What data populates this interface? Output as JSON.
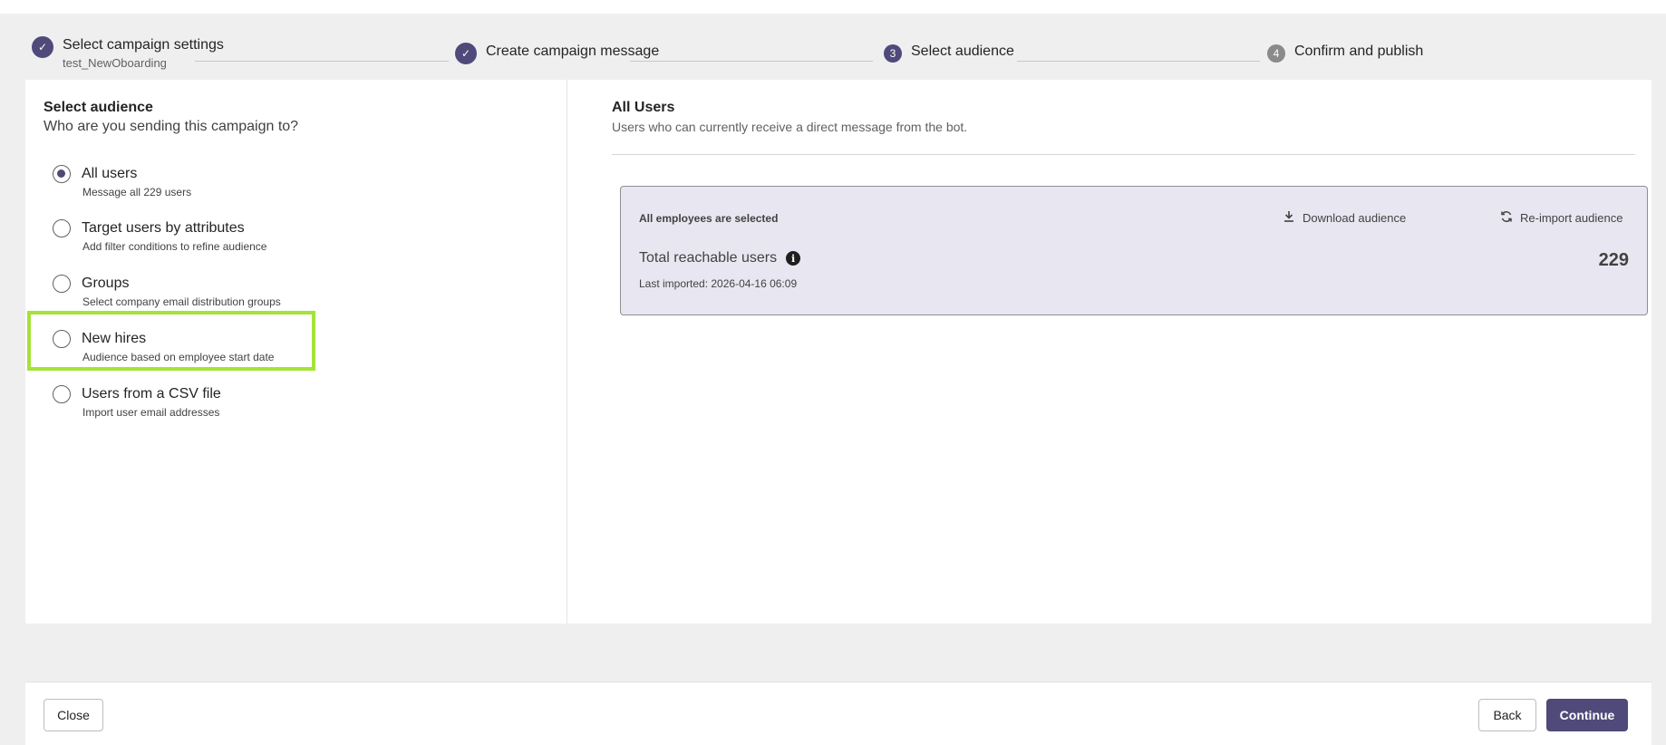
{
  "stepper": {
    "steps": [
      {
        "label": "Select campaign settings",
        "sub": "test_NewOboarding",
        "state": "done",
        "marker": "✓"
      },
      {
        "label": "Create campaign message",
        "sub": "",
        "state": "done",
        "marker": "✓"
      },
      {
        "label": "Select audience",
        "sub": "",
        "state": "active",
        "marker": "3"
      },
      {
        "label": "Confirm and publish",
        "sub": "",
        "state": "todo",
        "marker": "4"
      }
    ]
  },
  "left": {
    "title": "Select audience",
    "question": "Who are you sending this campaign to?",
    "options": [
      {
        "label": "All users",
        "desc": "Message all 229 users",
        "checked": true
      },
      {
        "label": "Target users by attributes",
        "desc": "Add filter conditions to refine audience",
        "checked": false
      },
      {
        "label": "Groups",
        "desc": "Select company email distribution groups",
        "checked": false
      },
      {
        "label": "New hires",
        "desc": "Audience based on employee start date",
        "checked": false
      },
      {
        "label": "Users from a CSV file",
        "desc": "Import user email addresses",
        "checked": false
      }
    ]
  },
  "right": {
    "title": "All Users",
    "desc": "Users who can currently receive a direct message from the bot.",
    "card": {
      "selected_text": "All employees are selected",
      "download_label": "Download audience",
      "reimport_label": "Re-import audience",
      "total_label": "Total reachable users",
      "total_count": "229",
      "last_imported": "Last imported: 2026-04-16 06:09"
    }
  },
  "footer": {
    "close_label": "Close",
    "back_label": "Back",
    "continue_label": "Continue"
  },
  "colors": {
    "accent": "#4f4a7a",
    "highlight": "#a5e23a",
    "card_bg": "#e8e6f0"
  },
  "icons": [
    "check-icon",
    "download-icon",
    "refresh-icon",
    "info-icon"
  ]
}
